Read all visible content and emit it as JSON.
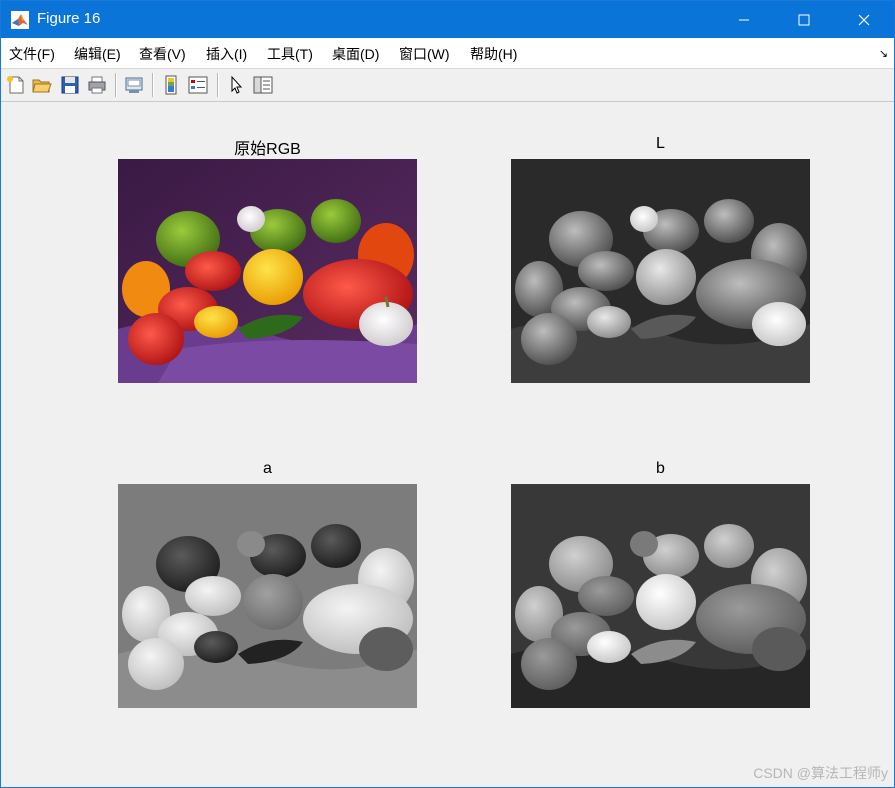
{
  "window": {
    "title": "Figure 16"
  },
  "menubar": {
    "items": [
      {
        "label": "文件(F)"
      },
      {
        "label": "编辑(E)"
      },
      {
        "label": "查看(V)"
      },
      {
        "label": "插入(I)"
      },
      {
        "label": "工具(T)"
      },
      {
        "label": "桌面(D)"
      },
      {
        "label": "窗口(W)"
      },
      {
        "label": "帮助(H)"
      }
    ]
  },
  "toolbar": {
    "buttons": [
      "new-figure-icon",
      "open-file-icon",
      "save-icon",
      "print-icon",
      "link-plot-icon",
      "colorbar-icon",
      "legend-icon",
      "edit-plot-pointer-icon",
      "property-inspector-icon"
    ]
  },
  "figure": {
    "panels": [
      {
        "title": "原始RGB",
        "image": "RGB photo of assorted peppers, garlic and purple cloth"
      },
      {
        "title": "L",
        "image": "grayscale lightness channel of peppers image"
      },
      {
        "title": "a",
        "image": "grayscale a* channel of peppers image"
      },
      {
        "title": "b",
        "image": "grayscale b* channel of peppers image"
      }
    ]
  },
  "watermark": "CSDN @算法工程师y",
  "colors": {
    "titlebar": "#0a74d8",
    "background": "#f0f0f0",
    "menubar": "#ffffff"
  }
}
